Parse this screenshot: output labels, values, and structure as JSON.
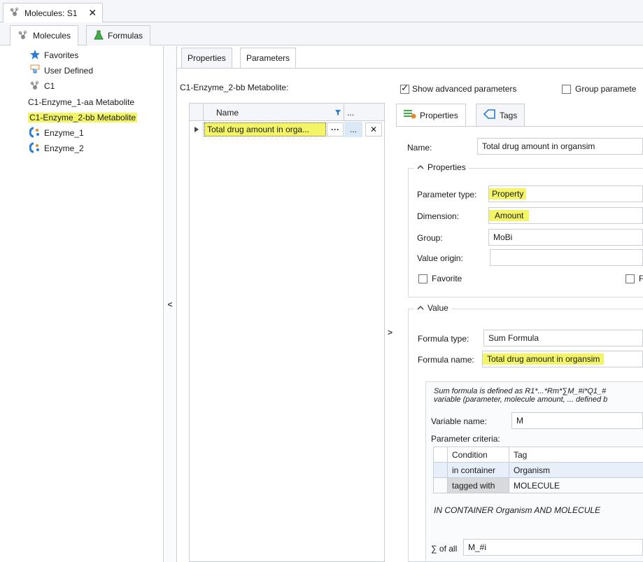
{
  "window": {
    "tab_title": "Molecules: S1",
    "close_glyph": "✕"
  },
  "sub_tabs": [
    {
      "label": "Molecules"
    },
    {
      "label": "Formulas"
    }
  ],
  "tree": {
    "items": [
      {
        "label": "Favorites",
        "icon": "star-icon"
      },
      {
        "label": "User Defined",
        "icon": "hand-icon"
      },
      {
        "label": "C1",
        "icon": "molecule-icon"
      },
      {
        "label": "C1-Enzyme_1-aa Metabolite",
        "icon": ""
      },
      {
        "label": "C1-Enzyme_2-bb Metabolite",
        "icon": ""
      },
      {
        "label": "Enzyme_1",
        "icon": "enzyme-icon"
      },
      {
        "label": "Enzyme_2",
        "icon": "enzyme-icon"
      }
    ]
  },
  "collapse_left_glyph": "<",
  "collapse_mid_glyph": ">",
  "param_tabs": [
    {
      "label": "Properties"
    },
    {
      "label": "Parameters"
    }
  ],
  "param_owner_label": "C1-Enzyme_2-bb Metabolite:",
  "grid": {
    "header_name": "Name",
    "header_more": "...",
    "row_name": "Total drug amount in orga...",
    "row_dots": "···",
    "row_more": "...",
    "row_delete": "✕"
  },
  "options": {
    "show_advanced_label": "Show advanced parameters",
    "show_advanced_checked": true,
    "group_params_label": "Group paramete"
  },
  "detail_tabs": [
    {
      "label": "Properties"
    },
    {
      "label": "Tags"
    }
  ],
  "detail": {
    "name_label": "Name:",
    "name_value": "Total drug amount in organsim",
    "properties_group_title": "Properties",
    "param_type_label": "Parameter type:",
    "param_type_value": "Property",
    "dimension_label": "Dimension:",
    "dimension_value": "Amount",
    "group_label": "Group:",
    "group_value": "MoBi",
    "value_origin_label": "Value origin:",
    "value_origin_value": "",
    "favorite_label": "Favorite",
    "cut_checkbox_label": "F",
    "value_group_title": "Value",
    "formula_type_label": "Formula type:",
    "formula_type_value": "Sum Formula",
    "formula_name_label": "Formula name:",
    "formula_name_value": "Total drug amount in organsim",
    "sum_desc_line1": "Sum formula is defined as R1*...*Rm*∑M_#i*Q1_#",
    "sum_desc_line2": "variable (parameter, molecule amount, ... defined b",
    "variable_name_label": "Variable name:",
    "variable_name_value": "M",
    "param_criteria_label": "Parameter criteria:",
    "criteria_headers": {
      "condition": "Condition",
      "tag": "Tag"
    },
    "criteria_rows": [
      {
        "condition": "in container",
        "tag": "Organism"
      },
      {
        "condition": "tagged with",
        "tag": "MOLECULE"
      }
    ],
    "criteria_summary": "IN CONTAINER Organism AND MOLECULE",
    "sum_of_all_label": "∑ of all",
    "sum_of_all_value": "M_#i"
  },
  "colors": {
    "highlight": "#f3f566",
    "accent": "#2b7bd6",
    "border": "#c9ced6"
  }
}
